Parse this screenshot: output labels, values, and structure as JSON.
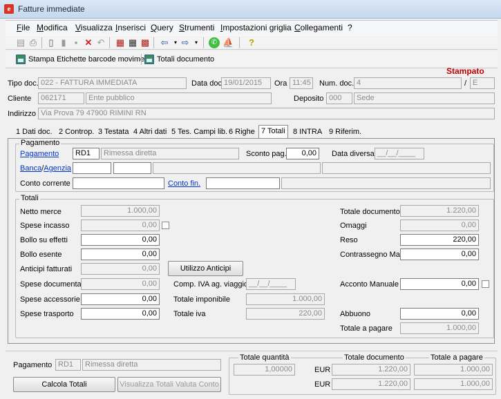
{
  "window": {
    "title": "Fatture immediate"
  },
  "menu": [
    "File",
    "Modifica",
    "Visualizza",
    "Inserisci",
    "Query",
    "Strumenti",
    "Impostazioni griglia",
    "Collegamenti",
    "?"
  ],
  "actions": {
    "stampa_etichette": "Stampa Etichette barcode movimenti",
    "totali_documento": "Totali documento"
  },
  "status": "Stampato",
  "header": {
    "tipo_doc_label": "Tipo doc.",
    "tipo_doc": "022 - FATTURA IMMEDIATA",
    "data_doc_label": "Data doc.",
    "data_doc": "19/01/2015",
    "ora_label": "Ora",
    "ora": "11:45",
    "num_doc_label": "Num. doc.",
    "num_doc": "4",
    "slash": "/",
    "serie": "E",
    "cliente_label": "Cliente",
    "cliente_code": "062171",
    "cliente_name": "Ente pubblico",
    "deposito_label": "Deposito",
    "deposito_code": "000",
    "deposito_name": "Sede",
    "indirizzo_label": "Indirizzo",
    "indirizzo": "Via Prova 79   47900   RIMINI   RN"
  },
  "tabs": [
    "1 Dati doc.",
    "2 Controp.",
    "3 Testata",
    "4 Altri dati",
    "5 Tes. Campi lib.",
    "6 Righe",
    "7 Totali",
    "8 INTRA",
    "9 Riferim."
  ],
  "pagamento": {
    "group": "Pagamento",
    "label": "Pagamento",
    "code": "RD1",
    "desc": "Rimessa diretta",
    "sconto_label": "Sconto pag.",
    "sconto": "0,00",
    "data_diversa_label": "Data diversa",
    "data_diversa": "__/__/____",
    "banca_label": "Banca",
    "agenzia_label": "Agenzia",
    "conto_corrente_label": "Conto corrente",
    "conto_fin_label": "Conto fin."
  },
  "totali": {
    "group": "Totali",
    "netto_merce_label": "Netto merce",
    "netto_merce": "1.000,00",
    "spese_incasso_label": "Spese incasso",
    "spese_incasso": "0,00",
    "bollo_effetti_label": "Bollo su effetti",
    "bollo_effetti": "0,00",
    "bollo_esente_label": "Bollo esente",
    "bollo_esente": "0,00",
    "anticipi_label": "Anticipi fatturati",
    "anticipi": "0,00",
    "utilizzo_anticipi": "Utilizzo Anticipi",
    "spese_doc_label": "Spese documentate",
    "spese_doc": "0,00",
    "comp_iva_label": "Comp. IVA ag. viaggio",
    "comp_iva": "__/__/____",
    "spese_acc_label": "Spese accessorie",
    "spese_acc": "0,00",
    "totale_imponibile_label": "Totale imponibile",
    "totale_imponibile": "1.000,00",
    "spese_trasp_label": "Spese trasporto",
    "spese_trasp": "0,00",
    "totale_iva_label": "Totale iva",
    "totale_iva": "220,00",
    "totale_documento_label": "Totale documento",
    "totale_documento": "1.220,00",
    "omaggi_label": "Omaggi",
    "omaggi": "0,00",
    "reso_label": "Reso",
    "reso": "220,00",
    "contrassegno_label": "Contrassegno Man.",
    "contrassegno": "0,00",
    "acconto_label": "Acconto Manuale",
    "acconto": "0,00",
    "abbuono_label": "Abbuono",
    "abbuono": "0,00",
    "totale_pagare_label": "Totale a pagare",
    "totale_pagare": "1.000,00"
  },
  "footer": {
    "pagamento_label": "Pagamento",
    "pagamento_code": "RD1",
    "pagamento_desc": "Rimessa diretta",
    "calcola_totali": "Calcola Totali",
    "visualizza_totali": "Visualizza Totali Valuta Conto",
    "totale_quantita_label": "Totale quantità",
    "totale_documento_label": "Totale documento",
    "totale_pagare_label": "Totale a pagare",
    "rows": [
      {
        "quantita": "1,00000",
        "currency": "EUR",
        "documento": "1.220,00",
        "pagare": "1.000,00"
      },
      {
        "quantita": "",
        "currency": "EUR",
        "documento": "1.220,00",
        "pagare": "1.000,00"
      }
    ]
  }
}
